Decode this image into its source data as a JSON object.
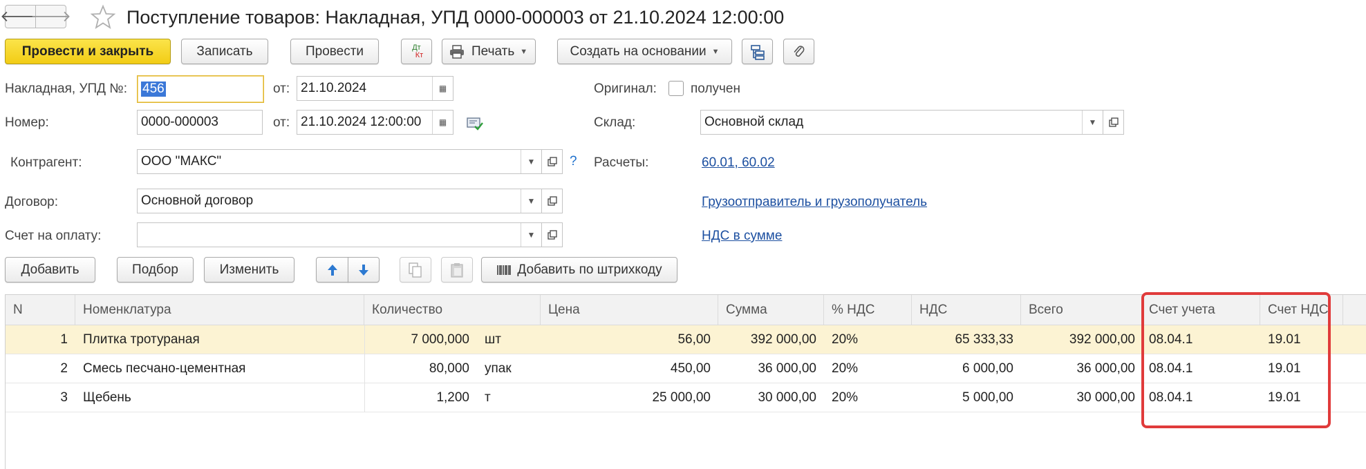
{
  "title": "Поступление товаров: Накладная, УПД 0000-000003 от 21.10.2024 12:00:00",
  "nav": {
    "back": "🡐",
    "forward": "🡒"
  },
  "toolbar": {
    "post_close": "Провести и закрыть",
    "save": "Записать",
    "post": "Провести",
    "dtkt_top": "Дт",
    "dtkt_bottom": "Кт",
    "print": "Печать",
    "create_based": "Создать на основании"
  },
  "form": {
    "invoice_label": "Накладная, УПД №:",
    "invoice_value": "456",
    "from_label": "от:",
    "invoice_date": "21.10.2024",
    "number_label": "Номер:",
    "number_value": "0000-000003",
    "number_date": "21.10.2024 12:00:00",
    "original_label": "Оригинал:",
    "original_checkbox": "получен",
    "warehouse_label": "Склад:",
    "warehouse_value": "Основной склад",
    "contractor_label": "Контрагент:",
    "contractor_value": "ООО \"МАКС\"",
    "help": "?",
    "settlements_label": "Расчеты:",
    "settlements_link": "60.01, 60.02",
    "contract_label": "Договор:",
    "contract_value": "Основной договор",
    "shipper_link": "Грузоотправитель и грузополучатель",
    "invoice_pay_label": "Счет на оплату:",
    "invoice_pay_value": "",
    "vat_link": "НДС в сумме"
  },
  "table_toolbar": {
    "add": "Добавить",
    "pick": "Подбор",
    "change": "Изменить",
    "add_barcode": "Добавить по штрихкоду"
  },
  "table": {
    "headers": {
      "n": "N",
      "item": "Номенклатура",
      "qty": "Количество",
      "price": "Цена",
      "sum": "Сумма",
      "vat_rate": "% НДС",
      "vat": "НДС",
      "total": "Всего",
      "account": "Счет учета",
      "vat_account": "Счет НДС"
    },
    "rows": [
      {
        "n": "1",
        "item": "Плитка тротураная",
        "qty": "7 000,000",
        "unit": "шт",
        "price": "56,00",
        "sum": "392 000,00",
        "vat_rate": "20%",
        "vat": "65 333,33",
        "total": "392 000,00",
        "account": "08.04.1",
        "vat_account": "19.01"
      },
      {
        "n": "2",
        "item": "Смесь песчано-цементная",
        "qty": "80,000",
        "unit": "упак",
        "price": "450,00",
        "sum": "36 000,00",
        "vat_rate": "20%",
        "vat": "6 000,00",
        "total": "36 000,00",
        "account": "08.04.1",
        "vat_account": "19.01"
      },
      {
        "n": "3",
        "item": "Щебень",
        "qty": "1,200",
        "unit": "т",
        "price": "25 000,00",
        "sum": "30 000,00",
        "vat_rate": "20%",
        "vat": "5 000,00",
        "total": "30 000,00",
        "account": "08.04.1",
        "vat_account": "19.01"
      }
    ]
  },
  "colors": {
    "primary": "#f5d320",
    "selected_row": "#fcf3d3",
    "highlight": "#e03b3b",
    "link": "#1c4fa0"
  }
}
